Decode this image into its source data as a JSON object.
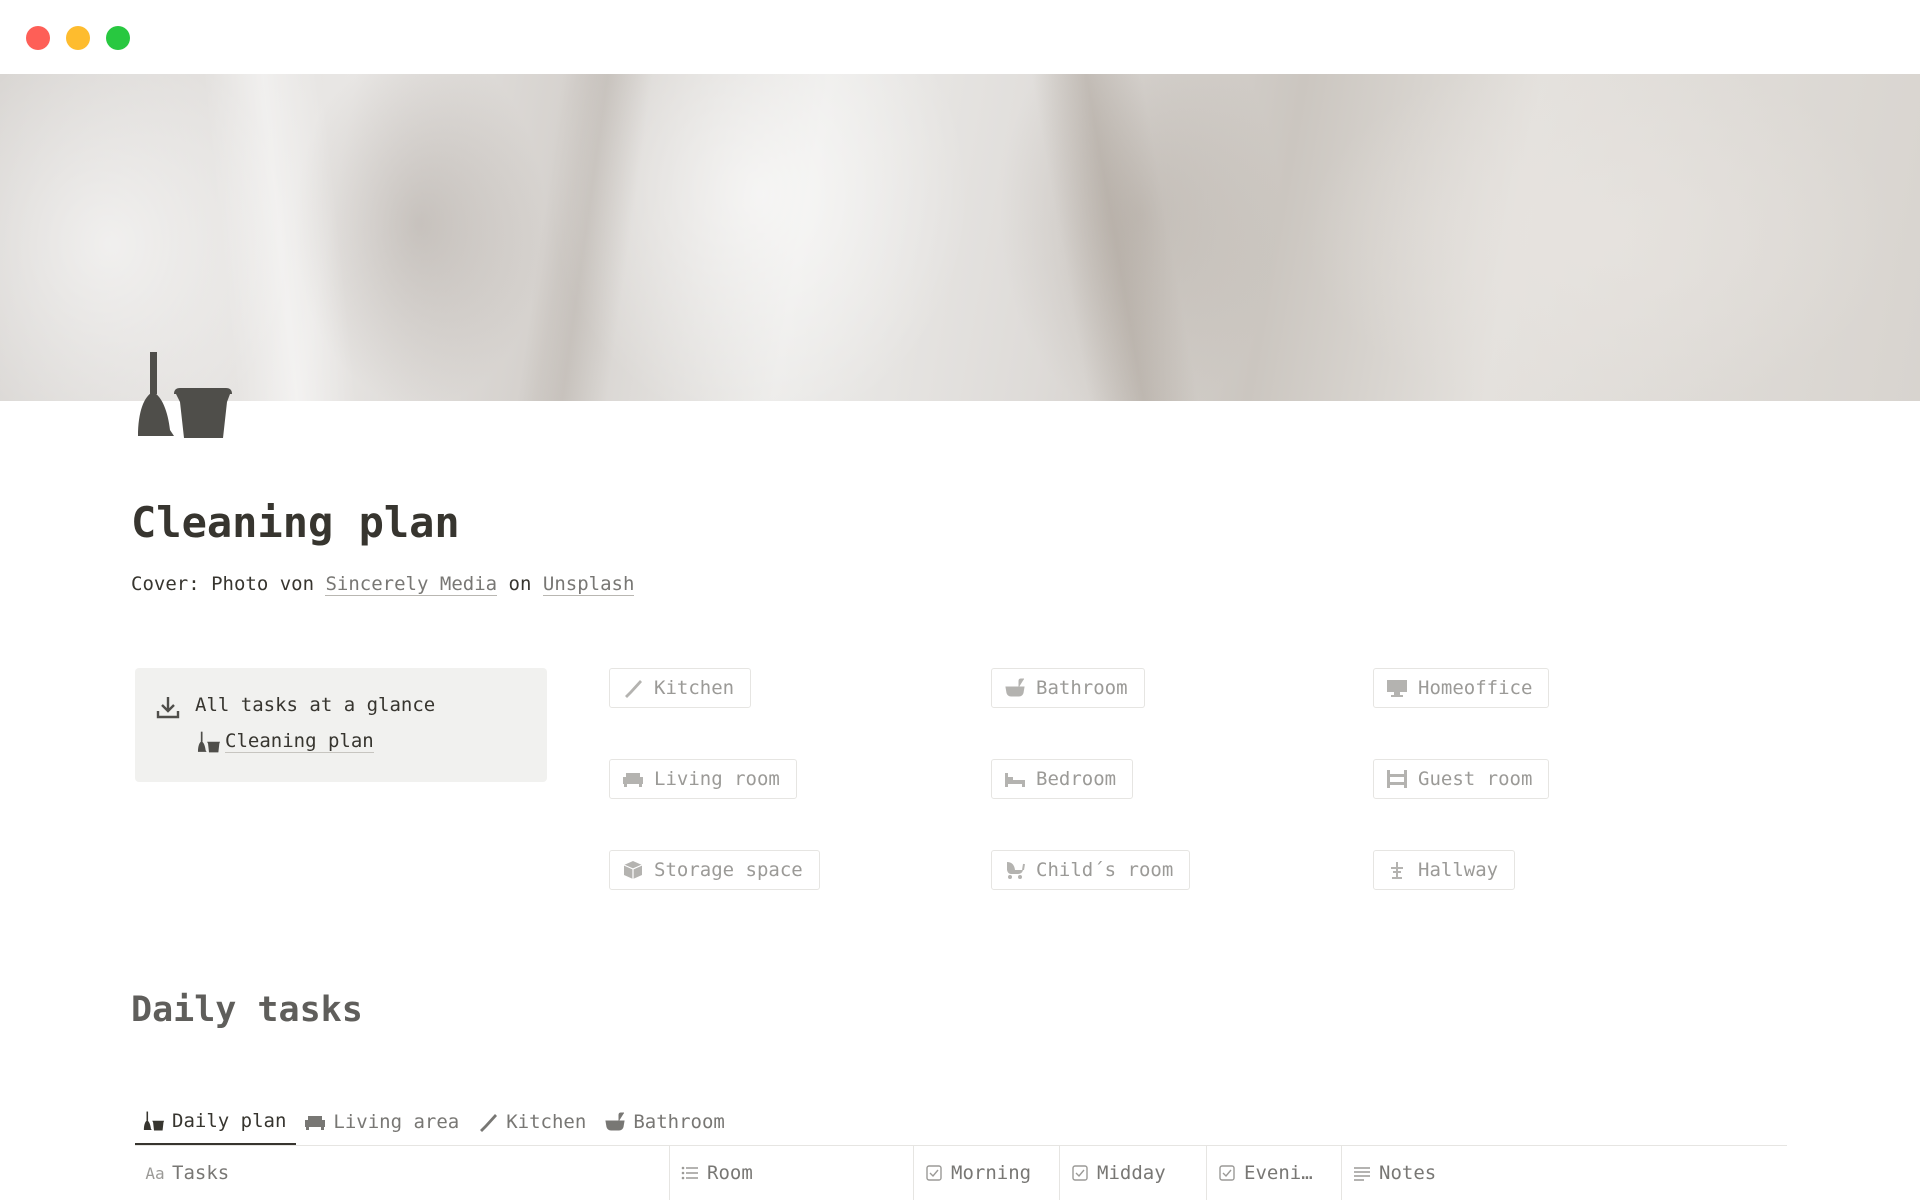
{
  "page": {
    "title": "Cleaning plan",
    "cover_credit": {
      "prefix": "Cover: Photo von",
      "author": "Sincerely Media",
      "joiner": "on",
      "source": "Unsplash"
    },
    "icon": "broom-bucket-icon"
  },
  "callout": {
    "icon": "download-icon",
    "text": "All tasks at a glance",
    "link_label": "Cleaning plan",
    "link_icon": "broom-bucket-icon"
  },
  "rooms": [
    {
      "label": "Kitchen",
      "icon": "knife-icon"
    },
    {
      "label": "Bathroom",
      "icon": "bathtub-icon"
    },
    {
      "label": "Homeoffice",
      "icon": "monitor-icon"
    },
    {
      "label": "Living room",
      "icon": "sofa-icon"
    },
    {
      "label": "Bedroom",
      "icon": "bed-icon"
    },
    {
      "label": "Guest room",
      "icon": "bunk-bed-icon"
    },
    {
      "label": "Storage space",
      "icon": "box-icon"
    },
    {
      "label": "Child´s room",
      "icon": "stroller-icon"
    },
    {
      "label": "Hallway",
      "icon": "coat-rack-icon"
    }
  ],
  "section": {
    "title": "Daily tasks"
  },
  "tabs": [
    {
      "label": "Daily plan",
      "icon": "broom-bucket-icon",
      "active": true
    },
    {
      "label": "Living area",
      "icon": "sofa-icon",
      "active": false
    },
    {
      "label": "Kitchen",
      "icon": "knife-icon",
      "active": false
    },
    {
      "label": "Bathroom",
      "icon": "bathtub-icon",
      "active": false
    }
  ],
  "table": {
    "columns": [
      {
        "label": "Tasks",
        "icon": "Aa"
      },
      {
        "label": "Room",
        "icon": "list-icon"
      },
      {
        "label": "Morning",
        "icon": "checkbox-icon"
      },
      {
        "label": "Midday",
        "icon": "checkbox-icon"
      },
      {
        "label": "Eveni…",
        "icon": "checkbox-icon"
      },
      {
        "label": "Notes",
        "icon": "text-lines-icon"
      }
    ]
  },
  "window_controls": {
    "close": "#fe5f57",
    "minimize": "#febc2e",
    "maximize": "#28c840"
  }
}
